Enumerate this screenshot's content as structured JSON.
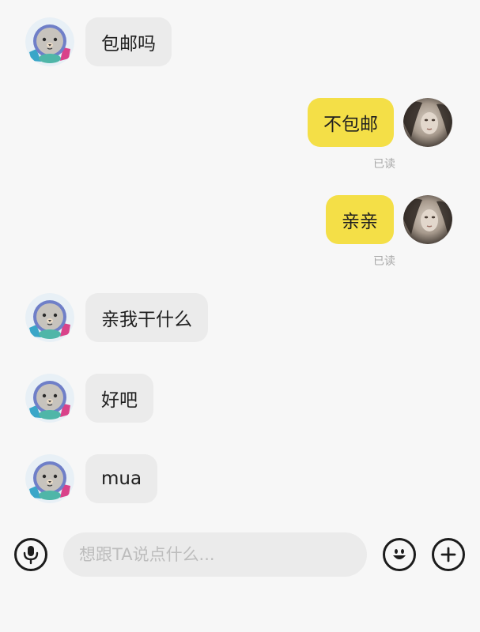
{
  "messages": [
    {
      "side": "in",
      "text": "包邮吗"
    },
    {
      "side": "out",
      "text": "不包邮",
      "status": "已读"
    },
    {
      "side": "out",
      "text": "亲亲",
      "status": "已读"
    },
    {
      "side": "in",
      "text": "亲我干什么"
    },
    {
      "side": "in",
      "text": "好吧"
    },
    {
      "side": "in",
      "text": "mua"
    }
  ],
  "input": {
    "placeholder": "想跟TA说点什么..."
  },
  "icons": {
    "voice": "microphone-icon",
    "emoji": "smiley-icon",
    "more": "plus-icon"
  },
  "colors": {
    "outgoing_bubble": "#f4df47",
    "incoming_bubble": "#ebebeb",
    "background": "#f7f7f7"
  }
}
